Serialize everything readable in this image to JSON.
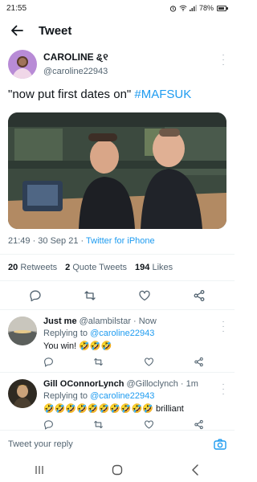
{
  "status": {
    "time": "21:55",
    "battery": "78%",
    "battery_level": 0.78
  },
  "header": {
    "title": "Tweet"
  },
  "tweet": {
    "author_name": "CAROLINE",
    "author_flag": "ୡ୧",
    "author_handle": "@caroline22943",
    "text": "\"now put first dates on\" ",
    "hashtag": "#MAFSUK",
    "time": "21:49 · 30 Sep 21 · ",
    "source": "Twitter for iPhone",
    "stats": {
      "retweets_count": "20",
      "retweets_label": "Retweets",
      "quotes_count": "2",
      "quotes_label": "Quote Tweets",
      "likes_count": "194",
      "likes_label": "Likes"
    }
  },
  "replies": [
    {
      "name": "Just me",
      "handle": "@alambilstar · Now",
      "replying_label": "Replying to ",
      "replying_to": "@caroline22943",
      "text": "You win! 🤣🤣🤣"
    },
    {
      "name": "Gill OConnorLynch",
      "handle": "@Gilloclynch · 1m",
      "replying_label": "Replying to ",
      "replying_to": "@caroline22943",
      "text": "🤣🤣🤣🤣🤣🤣🤣🤣🤣🤣 brilliant"
    }
  ],
  "compose": {
    "placeholder": "Tweet your reply"
  },
  "colors": {
    "accent": "#1d9bf0",
    "secondary_text": "#536471",
    "primary_text": "#0f1419"
  }
}
